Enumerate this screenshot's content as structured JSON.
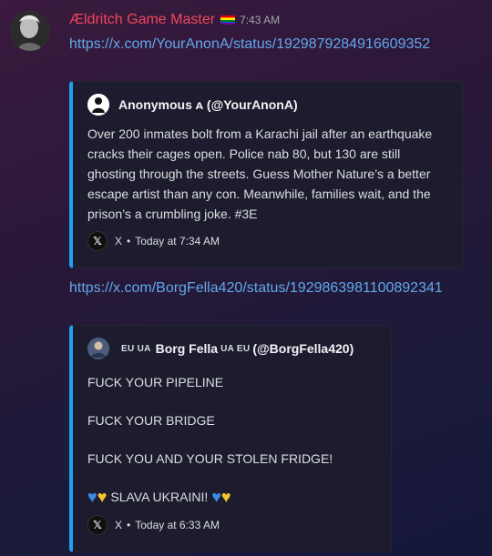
{
  "author": {
    "username": "Ældritch Game Master",
    "timestamp": "7:43 AM"
  },
  "messages": [
    {
      "link": "https://x.com/YourAnonA/status/1929879284916609352",
      "embed": {
        "author": "Anonymous ᴀ (@YourAnonA)",
        "description": "Over 200 inmates bolt from a Karachi jail after an earthquake cracks their cages open. Police nab 80, but 130 are still ghosting through the streets. Guess Mother Nature’s a better escape artist than any con. Meanwhile, families wait, and the prison’s a crumbling joke. #3E",
        "footer_source": "X",
        "footer_time": "Today at 7:34 AM"
      }
    },
    {
      "link": "https://x.com/BorgFella420/status/1929863981100892341",
      "embed": {
        "author_prefix": "EU UA",
        "author_name": "Borg Fella",
        "author_mid": "UA EU",
        "author_handle": "(@BorgFella420)",
        "lines": [
          "FUCK YOUR PIPELINE",
          "FUCK YOUR BRIDGE",
          "FUCK YOU AND YOUR STOLEN FRIDGE!"
        ],
        "slava": "SLAVA UKRAINI!",
        "footer_source": "X",
        "footer_time": "Today at 6:33 AM"
      }
    }
  ],
  "colors": {
    "username": "#f0465a",
    "link": "#62a8ec",
    "embed_accent": "#1ea1f2"
  },
  "icons": [
    "user-avatar",
    "rainbow-flag-icon",
    "x-logo-icon",
    "blue-heart-icon",
    "yellow-heart-icon"
  ]
}
